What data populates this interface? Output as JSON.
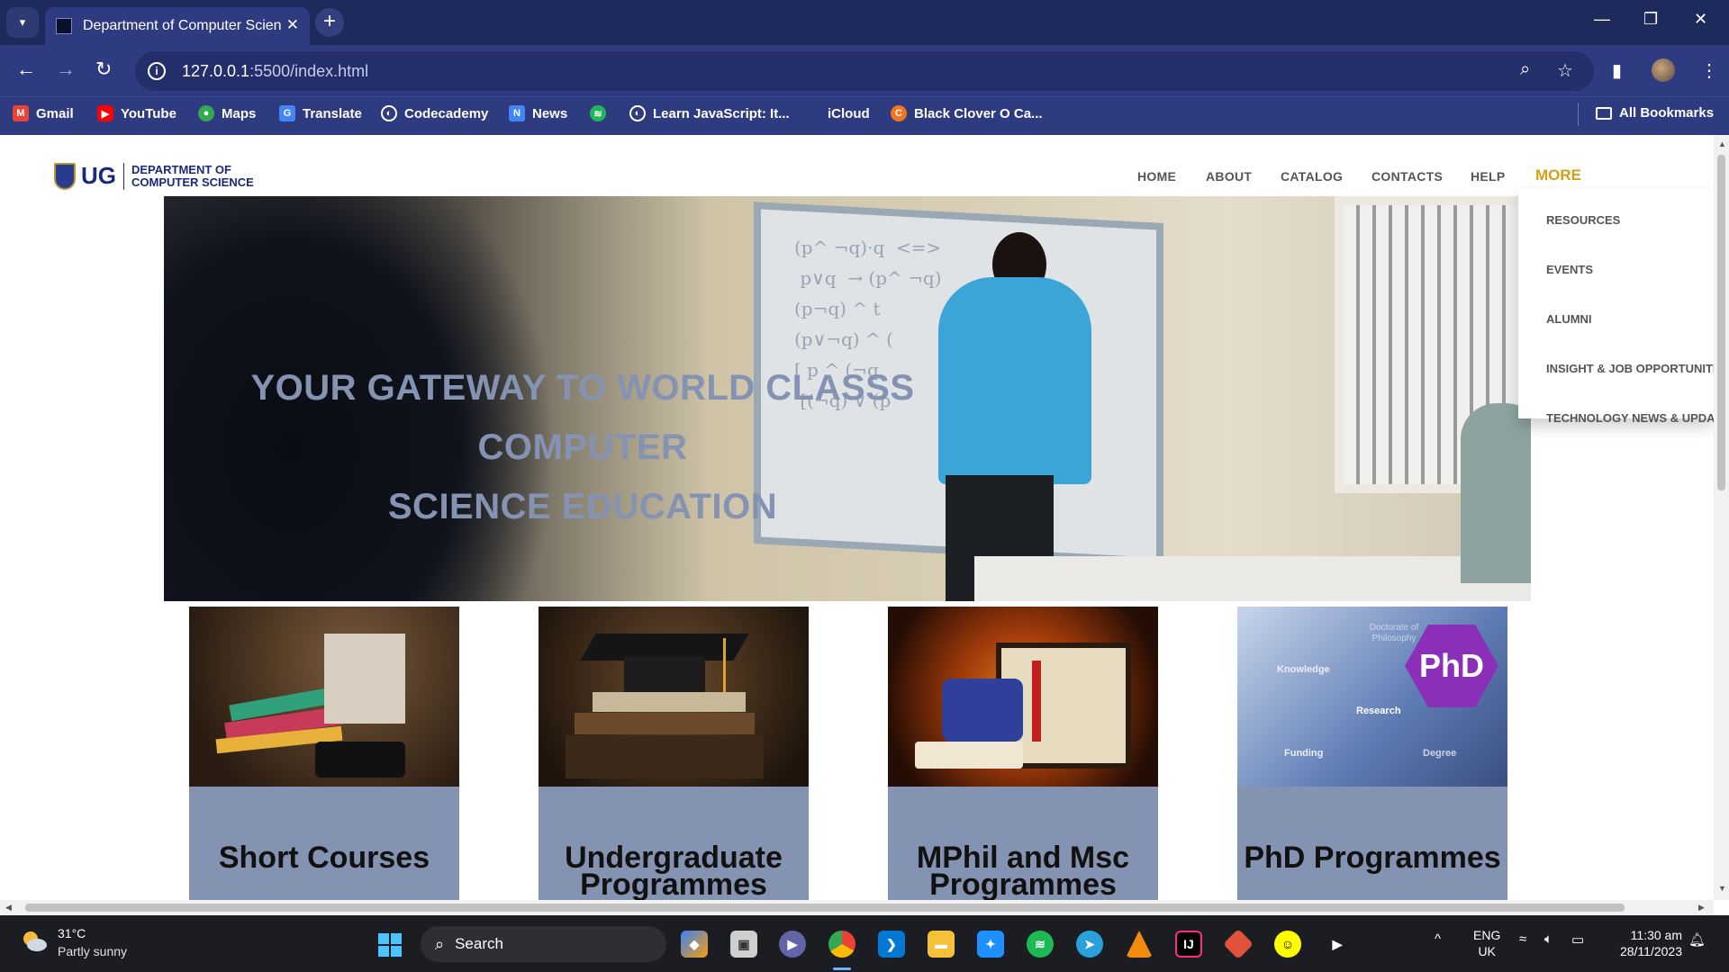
{
  "browser": {
    "tab_title": "Department of Computer Science",
    "url_host": "127.0.0.1",
    "url_path": ":5500/index.html",
    "bookmarks": [
      {
        "label": "Gmail",
        "icon": "gmail-icon",
        "color": "#ea4335"
      },
      {
        "label": "YouTube",
        "icon": "youtube-icon",
        "color": "#ff0000"
      },
      {
        "label": "Maps",
        "icon": "maps-icon",
        "color": "#34a853"
      },
      {
        "label": "Translate",
        "icon": "translate-icon",
        "color": "#4285f4"
      },
      {
        "label": "Codecademy",
        "icon": "globe-icon",
        "color": "#2f3b80"
      },
      {
        "label": "News",
        "icon": "news-icon",
        "color": "#4285f4"
      },
      {
        "label": "",
        "icon": "spotify-icon",
        "color": "#1db954"
      },
      {
        "label": "Learn JavaScript: It...",
        "icon": "globe-icon",
        "color": "#2f3b80"
      },
      {
        "label": "iCloud",
        "icon": "apple-icon",
        "color": "#9aa0b8"
      },
      {
        "label": "Black Clover O Ca...",
        "icon": "crunchyroll-icon",
        "color": "#f47521"
      }
    ],
    "all_bookmarks": "All Bookmarks"
  },
  "site": {
    "logo_ug": "UG",
    "logo_dept_line1": "DEPARTMENT OF",
    "logo_dept_line2": "COMPUTER SCIENCE",
    "nav": [
      "HOME",
      "ABOUT",
      "CATALOG",
      "CONTACTS",
      "HELP"
    ],
    "nav_more": "MORE",
    "dropdown": [
      "RESOURCES",
      "EVENTS",
      "ALUMNI",
      "INSIGHT & JOB OPPORTUNITIES",
      "TECHNOLOGY NEWS & UPDATES"
    ],
    "hero_line1": "YOUR GATEWAY TO WORLD CLASSS COMPUTER",
    "hero_line2": "SCIENCE EDUCATION",
    "cards": [
      {
        "line1": "Short Courses",
        "line2": ""
      },
      {
        "line1": "Undergraduate",
        "line2": "Programmes"
      },
      {
        "line1": "MPhil and Msc",
        "line2": "Programmes"
      },
      {
        "line1": "PhD Programmes",
        "line2": ""
      }
    ],
    "phd_img_labels": [
      "Doctorate of Philosophy",
      "Knowledge",
      "Research",
      "Funding",
      "Degree",
      "PhD"
    ],
    "accent_color": "#d4a017",
    "card_color": "#8593b3"
  },
  "taskbar": {
    "temp": "31°C",
    "weather": "Partly sunny",
    "search_placeholder": "Search",
    "lang1": "ENG",
    "lang2": "UK",
    "time": "11:30 am",
    "date": "28/11/2023"
  }
}
